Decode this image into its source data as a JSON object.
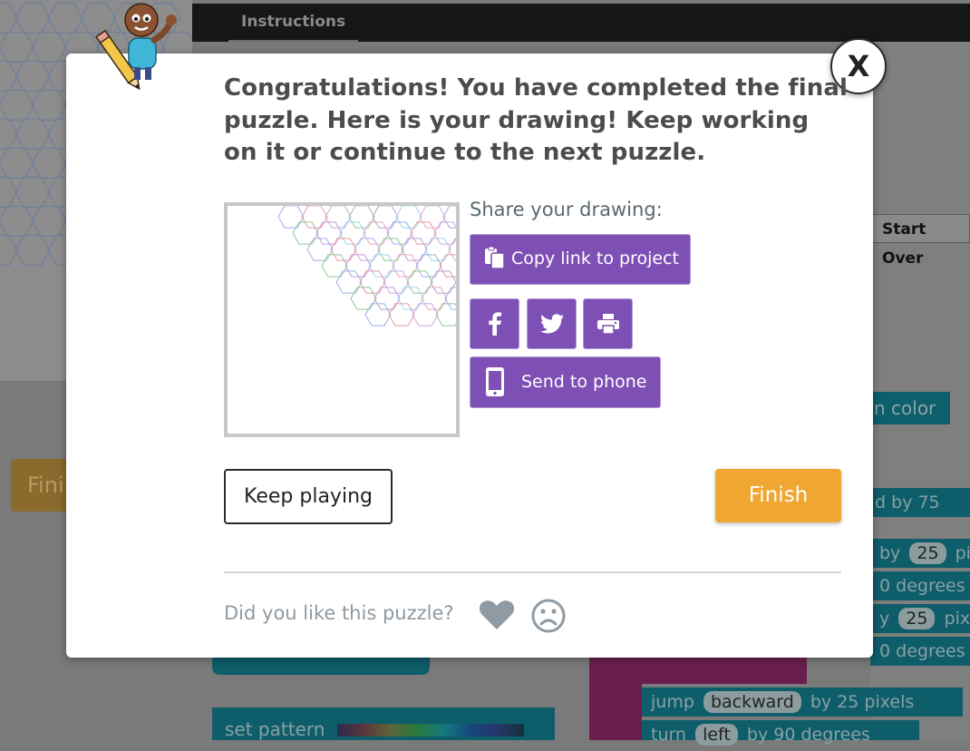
{
  "background": {
    "tab_label": "Instructions",
    "start_over_label": "Start Over",
    "pen_color_label": "n color",
    "finish_label": "Fini",
    "blocks": [
      {
        "text": "d",
        "chip": "",
        "tail": "by 75"
      },
      {
        "text": "by",
        "chip": "25",
        "tail": "pix"
      },
      {
        "text": "0",
        "chip": "",
        "tail": "degrees"
      },
      {
        "text": "y",
        "chip": "25",
        "tail": "pixe"
      },
      {
        "text": "0",
        "chip": "",
        "tail": "degrees"
      },
      {
        "text": "jump",
        "chip": "backward",
        "tail": "by 25 pixels"
      },
      {
        "text": "turn",
        "chip": "left",
        "tail": "by 90 degrees"
      }
    ],
    "set_pattern_label": "set pattern"
  },
  "modal": {
    "close_label": "X",
    "headline": "Congratulations! You have completed the final puzzle. Here is your drawing! Keep working on it or continue to the next puzzle.",
    "share_label": "Share your drawing:",
    "copy_link_label": "Copy link to project",
    "send_to_phone_label": "Send to phone",
    "keep_playing_label": "Keep playing",
    "finish_label": "Finish",
    "feedback_question": "Did you like this puzzle?"
  },
  "icons": {
    "copy": "clipboard-icon",
    "facebook": "facebook-icon",
    "twitter": "twitter-icon",
    "print": "printer-icon",
    "phone": "phone-icon",
    "like": "heart-icon",
    "dislike": "sad-face-icon"
  },
  "colors": {
    "purple": "#7e4fb4",
    "orange": "#f0a731",
    "text_dark": "#4c4c4c",
    "muted": "#8f9aa2"
  }
}
